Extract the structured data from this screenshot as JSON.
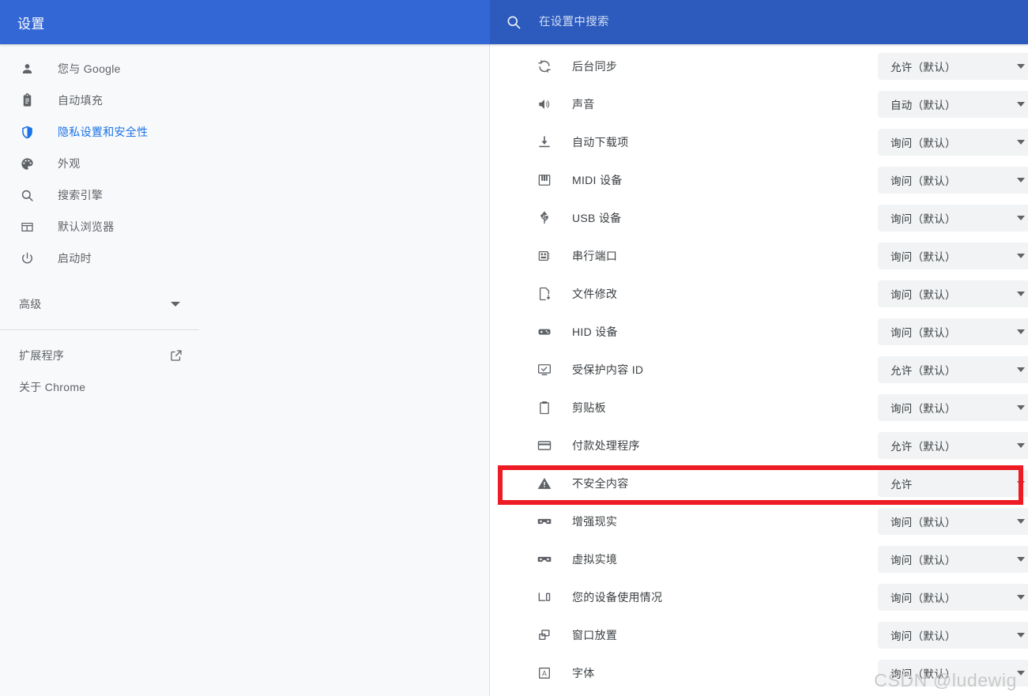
{
  "header": {
    "title": "设置",
    "search_icon": "search-icon",
    "search_value": "",
    "search_placeholder": "在设置中搜索",
    "bg_color": "#3367d6",
    "search_bg_color": "#2c5bbd"
  },
  "sidebar": {
    "items": [
      {
        "label": "您与 Google",
        "icon": "person-icon",
        "active": false
      },
      {
        "label": "自动填充",
        "icon": "clipboard-icon",
        "active": false
      },
      {
        "label": "隐私设置和安全性",
        "icon": "shield-icon",
        "active": true
      },
      {
        "label": "外观",
        "icon": "palette-icon",
        "active": false
      },
      {
        "label": "搜索引擎",
        "icon": "search-icon",
        "active": false
      },
      {
        "label": "默认浏览器",
        "icon": "browser-window-icon",
        "active": false
      },
      {
        "label": "启动时",
        "icon": "power-icon",
        "active": false
      }
    ],
    "advanced": {
      "label": "高级",
      "icon": "chevron-down-icon"
    },
    "footer_items": [
      {
        "label": "扩展程序",
        "icon": "external-link-icon"
      },
      {
        "label": "关于 Chrome",
        "icon": null
      }
    ],
    "active_color": "#1a73e8",
    "bg_color": "#f8f9fa"
  },
  "main": {
    "rows": [
      {
        "label": "后台同步",
        "icon": "sync-icon",
        "value": "允许（默认）",
        "highlighted": false
      },
      {
        "label": "声音",
        "icon": "volume-icon",
        "value": "自动（默认）",
        "highlighted": false
      },
      {
        "label": "自动下载项",
        "icon": "download-icon",
        "value": "询问（默认）",
        "highlighted": false
      },
      {
        "label": "MIDI 设备",
        "icon": "midi-piano-icon",
        "value": "询问（默认）",
        "highlighted": false
      },
      {
        "label": "USB 设备",
        "icon": "usb-icon",
        "value": "询问（默认）",
        "highlighted": false
      },
      {
        "label": "串行端口",
        "icon": "serial-port-icon",
        "value": "询问（默认）",
        "highlighted": false
      },
      {
        "label": "文件修改",
        "icon": "file-edit-icon",
        "value": "询问（默认）",
        "highlighted": false
      },
      {
        "label": "HID 设备",
        "icon": "hid-gamepad-icon",
        "value": "询问（默认）",
        "highlighted": false
      },
      {
        "label": "受保护内容 ID",
        "icon": "protected-content-icon",
        "value": "允许（默认）",
        "highlighted": false
      },
      {
        "label": "剪贴板",
        "icon": "clipboard-icon",
        "value": "询问（默认）",
        "highlighted": false
      },
      {
        "label": "付款处理程序",
        "icon": "payment-card-icon",
        "value": "允许（默认）",
        "highlighted": false
      },
      {
        "label": "不安全内容",
        "icon": "warning-triangle-icon",
        "value": "允许",
        "highlighted": true
      },
      {
        "label": "增强现实",
        "icon": "vr-goggles-icon",
        "value": "询问（默认）",
        "highlighted": false
      },
      {
        "label": "虚拟实境",
        "icon": "vr-goggles-icon",
        "value": "询问（默认）",
        "highlighted": false
      },
      {
        "label": "您的设备使用情况",
        "icon": "device-usage-icon",
        "value": "询问（默认）",
        "highlighted": false
      },
      {
        "label": "窗口放置",
        "icon": "window-placement-icon",
        "value": "询问（默认）",
        "highlighted": false
      },
      {
        "label": "字体",
        "icon": "font-icon",
        "value": "询问（默认）",
        "highlighted": false
      }
    ],
    "highlight_color": "#ed1c24",
    "select_bg_color": "#f1f3f4"
  },
  "watermark": {
    "text": "CSDN @ludewig"
  }
}
